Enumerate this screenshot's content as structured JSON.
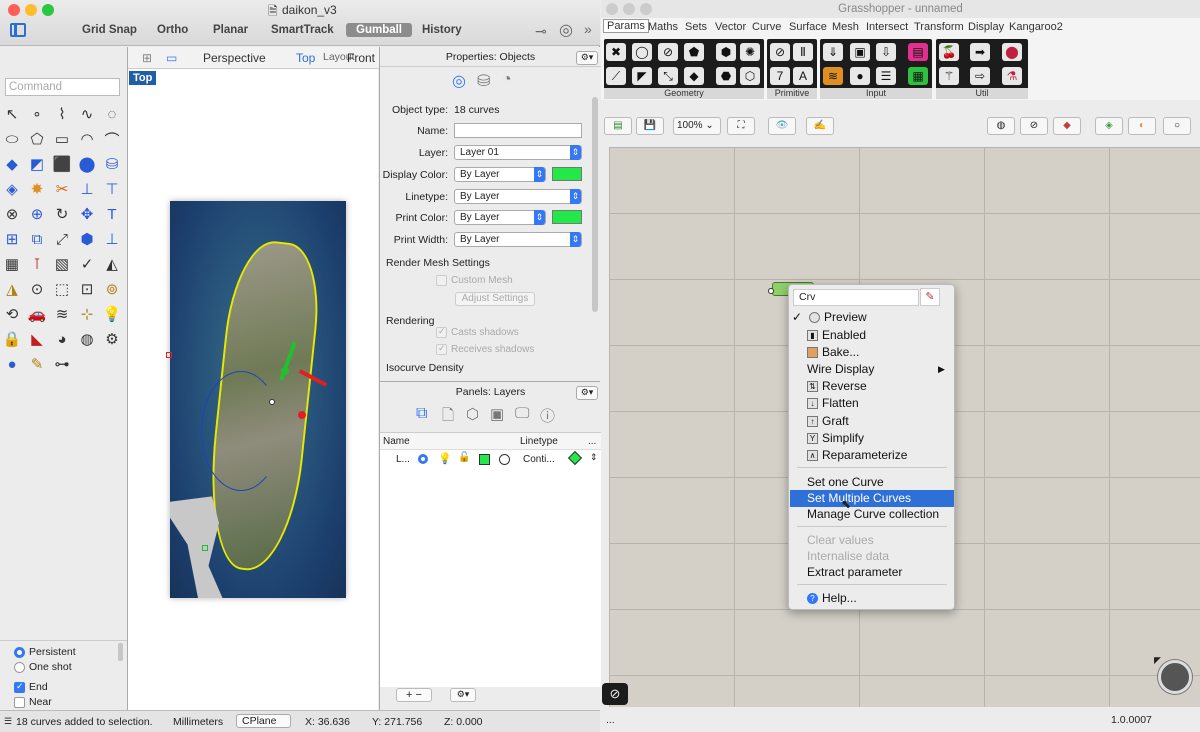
{
  "rhino": {
    "window_title": "daikon_v3",
    "toolbar_tabs": [
      "Grid Snap",
      "Ortho",
      "Planar",
      "SmartTrack",
      "Gumball",
      "History"
    ],
    "command_placeholder": "Command",
    "viewport": {
      "tabs": [
        "Perspective",
        "Top",
        "Layout",
        "Front"
      ],
      "active_view": "Top",
      "label": "Top"
    },
    "osnap": {
      "persistent": "Persistent",
      "one_shot": "One shot",
      "end": "End",
      "near": "Near"
    },
    "status": {
      "message": "18 curves added to selection.",
      "units": "Millimeters",
      "plane": "CPlane",
      "x": "X: 36.636",
      "y": "Y: 271.756",
      "z": "Z: 0.000"
    }
  },
  "properties": {
    "title": "Properties: Objects",
    "object_type_label": "Object type:",
    "object_type_value": "18 curves",
    "name_label": "Name:",
    "layer_label": "Layer:",
    "layer_value": "Layer 01",
    "display_color_label": "Display Color:",
    "display_color_value": "By Layer",
    "linetype_label": "Linetype:",
    "linetype_value": "By Layer",
    "print_color_label": "Print Color:",
    "print_color_value": "By Layer",
    "print_width_label": "Print Width:",
    "print_width_value": "By Layer",
    "render_mesh_header": "Render Mesh Settings",
    "custom_mesh": "Custom Mesh",
    "adjust_settings": "Adjust Settings",
    "rendering_header": "Rendering",
    "casts_shadows": "Casts shadows",
    "receives_shadows": "Receives shadows",
    "isocurve_header": "Isocurve Density",
    "swatch_color": "#22e84a"
  },
  "layers_panel": {
    "title": "Panels: Layers",
    "columns": [
      "Name",
      "Linetype",
      "..."
    ],
    "row": {
      "name": "L...",
      "linetype": "Conti..."
    }
  },
  "grasshopper": {
    "window_title": "Grasshopper - unnamed",
    "menu": [
      "Params",
      "Maths",
      "Sets",
      "Vector",
      "Curve",
      "Surface",
      "Mesh",
      "Intersect",
      "Transform",
      "Display",
      "Kangaroo2"
    ],
    "ribbon_groups": [
      "Geometry",
      "Primitive",
      "Input",
      "Util"
    ],
    "zoom": "100%",
    "status_left": "...",
    "version": "1.0.0007"
  },
  "context_menu": {
    "input_value": "Crv",
    "items": [
      "Preview",
      "Enabled",
      "Bake...",
      "Wire Display",
      "Reverse",
      "Flatten",
      "Graft",
      "Simplify",
      "Reparameterize"
    ],
    "set_one": "Set one Curve",
    "set_multiple": "Set Multiple Curves",
    "manage": "Manage Curve collection",
    "clear": "Clear values",
    "internalise": "Internalise data",
    "extract": "Extract parameter",
    "help": "Help..."
  }
}
